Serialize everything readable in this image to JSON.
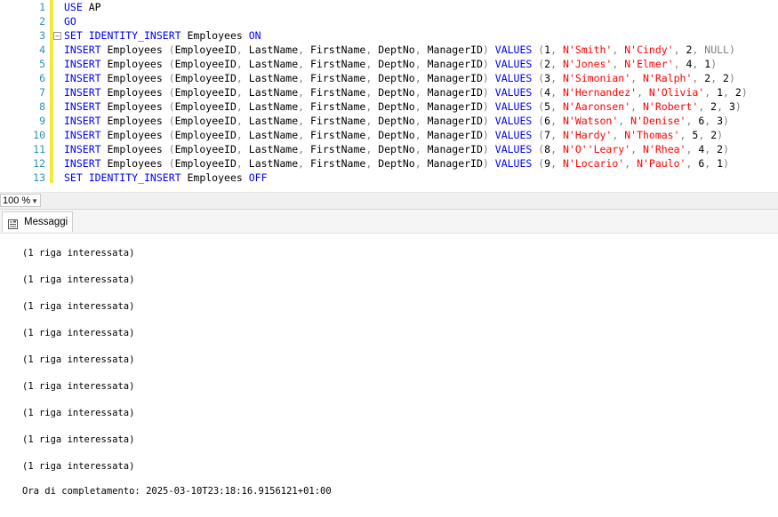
{
  "editor": {
    "lines": [
      {
        "n": "1",
        "tokens": [
          {
            "t": "USE",
            "c": "kw"
          },
          {
            "t": " AP",
            "c": "id"
          }
        ]
      },
      {
        "n": "2",
        "tokens": [
          {
            "t": "GO",
            "c": "kw"
          }
        ]
      },
      {
        "n": "3",
        "fold": true,
        "tokens": [
          {
            "t": "SET IDENTITY_INSERT",
            "c": "kw"
          },
          {
            "t": " Employees ",
            "c": "id"
          },
          {
            "t": "ON",
            "c": "kw"
          }
        ]
      },
      {
        "n": "4",
        "tokens": [
          {
            "t": "INSERT",
            "c": "kw"
          },
          {
            "t": " Employees ",
            "c": "id"
          },
          {
            "t": "(",
            "c": "gr"
          },
          {
            "t": "EmployeeID",
            "c": "id"
          },
          {
            "t": ", ",
            "c": "gr"
          },
          {
            "t": "LastName",
            "c": "id"
          },
          {
            "t": ", ",
            "c": "gr"
          },
          {
            "t": "FirstName",
            "c": "id"
          },
          {
            "t": ", ",
            "c": "gr"
          },
          {
            "t": "DeptNo",
            "c": "id"
          },
          {
            "t": ", ",
            "c": "gr"
          },
          {
            "t": "ManagerID",
            "c": "id"
          },
          {
            "t": ") ",
            "c": "gr"
          },
          {
            "t": "VALUES",
            "c": "kw"
          },
          {
            "t": " (",
            "c": "gr"
          },
          {
            "t": "1",
            "c": "num"
          },
          {
            "t": ", ",
            "c": "gr"
          },
          {
            "t": "N'Smith'",
            "c": "str"
          },
          {
            "t": ", ",
            "c": "gr"
          },
          {
            "t": "N'Cindy'",
            "c": "str"
          },
          {
            "t": ", ",
            "c": "gr"
          },
          {
            "t": "2",
            "c": "num"
          },
          {
            "t": ", ",
            "c": "gr"
          },
          {
            "t": "NULL",
            "c": "nul"
          },
          {
            "t": ")",
            "c": "gr"
          }
        ]
      },
      {
        "n": "5",
        "tokens": [
          {
            "t": "INSERT",
            "c": "kw"
          },
          {
            "t": " Employees ",
            "c": "id"
          },
          {
            "t": "(",
            "c": "gr"
          },
          {
            "t": "EmployeeID",
            "c": "id"
          },
          {
            "t": ", ",
            "c": "gr"
          },
          {
            "t": "LastName",
            "c": "id"
          },
          {
            "t": ", ",
            "c": "gr"
          },
          {
            "t": "FirstName",
            "c": "id"
          },
          {
            "t": ", ",
            "c": "gr"
          },
          {
            "t": "DeptNo",
            "c": "id"
          },
          {
            "t": ", ",
            "c": "gr"
          },
          {
            "t": "ManagerID",
            "c": "id"
          },
          {
            "t": ") ",
            "c": "gr"
          },
          {
            "t": "VALUES",
            "c": "kw"
          },
          {
            "t": " (",
            "c": "gr"
          },
          {
            "t": "2",
            "c": "num"
          },
          {
            "t": ", ",
            "c": "gr"
          },
          {
            "t": "N'Jones'",
            "c": "str"
          },
          {
            "t": ", ",
            "c": "gr"
          },
          {
            "t": "N'Elmer'",
            "c": "str"
          },
          {
            "t": ", ",
            "c": "gr"
          },
          {
            "t": "4",
            "c": "num"
          },
          {
            "t": ", ",
            "c": "gr"
          },
          {
            "t": "1",
            "c": "num"
          },
          {
            "t": ")",
            "c": "gr"
          }
        ]
      },
      {
        "n": "6",
        "tokens": [
          {
            "t": "INSERT",
            "c": "kw"
          },
          {
            "t": " Employees ",
            "c": "id"
          },
          {
            "t": "(",
            "c": "gr"
          },
          {
            "t": "EmployeeID",
            "c": "id"
          },
          {
            "t": ", ",
            "c": "gr"
          },
          {
            "t": "LastName",
            "c": "id"
          },
          {
            "t": ", ",
            "c": "gr"
          },
          {
            "t": "FirstName",
            "c": "id"
          },
          {
            "t": ", ",
            "c": "gr"
          },
          {
            "t": "DeptNo",
            "c": "id"
          },
          {
            "t": ", ",
            "c": "gr"
          },
          {
            "t": "ManagerID",
            "c": "id"
          },
          {
            "t": ") ",
            "c": "gr"
          },
          {
            "t": "VALUES",
            "c": "kw"
          },
          {
            "t": " (",
            "c": "gr"
          },
          {
            "t": "3",
            "c": "num"
          },
          {
            "t": ", ",
            "c": "gr"
          },
          {
            "t": "N'Simonian'",
            "c": "str"
          },
          {
            "t": ", ",
            "c": "gr"
          },
          {
            "t": "N'Ralph'",
            "c": "str"
          },
          {
            "t": ", ",
            "c": "gr"
          },
          {
            "t": "2",
            "c": "num"
          },
          {
            "t": ", ",
            "c": "gr"
          },
          {
            "t": "2",
            "c": "num"
          },
          {
            "t": ")",
            "c": "gr"
          }
        ]
      },
      {
        "n": "7",
        "tokens": [
          {
            "t": "INSERT",
            "c": "kw"
          },
          {
            "t": " Employees ",
            "c": "id"
          },
          {
            "t": "(",
            "c": "gr"
          },
          {
            "t": "EmployeeID",
            "c": "id"
          },
          {
            "t": ", ",
            "c": "gr"
          },
          {
            "t": "LastName",
            "c": "id"
          },
          {
            "t": ", ",
            "c": "gr"
          },
          {
            "t": "FirstName",
            "c": "id"
          },
          {
            "t": ", ",
            "c": "gr"
          },
          {
            "t": "DeptNo",
            "c": "id"
          },
          {
            "t": ", ",
            "c": "gr"
          },
          {
            "t": "ManagerID",
            "c": "id"
          },
          {
            "t": ") ",
            "c": "gr"
          },
          {
            "t": "VALUES",
            "c": "kw"
          },
          {
            "t": " (",
            "c": "gr"
          },
          {
            "t": "4",
            "c": "num"
          },
          {
            "t": ", ",
            "c": "gr"
          },
          {
            "t": "N'Hernandez'",
            "c": "str"
          },
          {
            "t": ", ",
            "c": "gr"
          },
          {
            "t": "N'Olivia'",
            "c": "str"
          },
          {
            "t": ", ",
            "c": "gr"
          },
          {
            "t": "1",
            "c": "num"
          },
          {
            "t": ", ",
            "c": "gr"
          },
          {
            "t": "2",
            "c": "num"
          },
          {
            "t": ")",
            "c": "gr"
          }
        ]
      },
      {
        "n": "8",
        "tokens": [
          {
            "t": "INSERT",
            "c": "kw"
          },
          {
            "t": " Employees ",
            "c": "id"
          },
          {
            "t": "(",
            "c": "gr"
          },
          {
            "t": "EmployeeID",
            "c": "id"
          },
          {
            "t": ", ",
            "c": "gr"
          },
          {
            "t": "LastName",
            "c": "id"
          },
          {
            "t": ", ",
            "c": "gr"
          },
          {
            "t": "FirstName",
            "c": "id"
          },
          {
            "t": ", ",
            "c": "gr"
          },
          {
            "t": "DeptNo",
            "c": "id"
          },
          {
            "t": ", ",
            "c": "gr"
          },
          {
            "t": "ManagerID",
            "c": "id"
          },
          {
            "t": ") ",
            "c": "gr"
          },
          {
            "t": "VALUES",
            "c": "kw"
          },
          {
            "t": " (",
            "c": "gr"
          },
          {
            "t": "5",
            "c": "num"
          },
          {
            "t": ", ",
            "c": "gr"
          },
          {
            "t": "N'Aaronsen'",
            "c": "str"
          },
          {
            "t": ", ",
            "c": "gr"
          },
          {
            "t": "N'Robert'",
            "c": "str"
          },
          {
            "t": ", ",
            "c": "gr"
          },
          {
            "t": "2",
            "c": "num"
          },
          {
            "t": ", ",
            "c": "gr"
          },
          {
            "t": "3",
            "c": "num"
          },
          {
            "t": ")",
            "c": "gr"
          }
        ]
      },
      {
        "n": "9",
        "tokens": [
          {
            "t": "INSERT",
            "c": "kw"
          },
          {
            "t": " Employees ",
            "c": "id"
          },
          {
            "t": "(",
            "c": "gr"
          },
          {
            "t": "EmployeeID",
            "c": "id"
          },
          {
            "t": ", ",
            "c": "gr"
          },
          {
            "t": "LastName",
            "c": "id"
          },
          {
            "t": ", ",
            "c": "gr"
          },
          {
            "t": "FirstName",
            "c": "id"
          },
          {
            "t": ", ",
            "c": "gr"
          },
          {
            "t": "DeptNo",
            "c": "id"
          },
          {
            "t": ", ",
            "c": "gr"
          },
          {
            "t": "ManagerID",
            "c": "id"
          },
          {
            "t": ") ",
            "c": "gr"
          },
          {
            "t": "VALUES",
            "c": "kw"
          },
          {
            "t": " (",
            "c": "gr"
          },
          {
            "t": "6",
            "c": "num"
          },
          {
            "t": ", ",
            "c": "gr"
          },
          {
            "t": "N'Watson'",
            "c": "str"
          },
          {
            "t": ", ",
            "c": "gr"
          },
          {
            "t": "N'Denise'",
            "c": "str"
          },
          {
            "t": ", ",
            "c": "gr"
          },
          {
            "t": "6",
            "c": "num"
          },
          {
            "t": ", ",
            "c": "gr"
          },
          {
            "t": "3",
            "c": "num"
          },
          {
            "t": ")",
            "c": "gr"
          }
        ]
      },
      {
        "n": "10",
        "tokens": [
          {
            "t": "INSERT",
            "c": "kw"
          },
          {
            "t": " Employees ",
            "c": "id"
          },
          {
            "t": "(",
            "c": "gr"
          },
          {
            "t": "EmployeeID",
            "c": "id"
          },
          {
            "t": ", ",
            "c": "gr"
          },
          {
            "t": "LastName",
            "c": "id"
          },
          {
            "t": ", ",
            "c": "gr"
          },
          {
            "t": "FirstName",
            "c": "id"
          },
          {
            "t": ", ",
            "c": "gr"
          },
          {
            "t": "DeptNo",
            "c": "id"
          },
          {
            "t": ", ",
            "c": "gr"
          },
          {
            "t": "ManagerID",
            "c": "id"
          },
          {
            "t": ") ",
            "c": "gr"
          },
          {
            "t": "VALUES",
            "c": "kw"
          },
          {
            "t": " (",
            "c": "gr"
          },
          {
            "t": "7",
            "c": "num"
          },
          {
            "t": ", ",
            "c": "gr"
          },
          {
            "t": "N'Hardy'",
            "c": "str"
          },
          {
            "t": ", ",
            "c": "gr"
          },
          {
            "t": "N'Thomas'",
            "c": "str"
          },
          {
            "t": ", ",
            "c": "gr"
          },
          {
            "t": "5",
            "c": "num"
          },
          {
            "t": ", ",
            "c": "gr"
          },
          {
            "t": "2",
            "c": "num"
          },
          {
            "t": ")",
            "c": "gr"
          }
        ]
      },
      {
        "n": "11",
        "tokens": [
          {
            "t": "INSERT",
            "c": "kw"
          },
          {
            "t": " Employees ",
            "c": "id"
          },
          {
            "t": "(",
            "c": "gr"
          },
          {
            "t": "EmployeeID",
            "c": "id"
          },
          {
            "t": ", ",
            "c": "gr"
          },
          {
            "t": "LastName",
            "c": "id"
          },
          {
            "t": ", ",
            "c": "gr"
          },
          {
            "t": "FirstName",
            "c": "id"
          },
          {
            "t": ", ",
            "c": "gr"
          },
          {
            "t": "DeptNo",
            "c": "id"
          },
          {
            "t": ", ",
            "c": "gr"
          },
          {
            "t": "ManagerID",
            "c": "id"
          },
          {
            "t": ") ",
            "c": "gr"
          },
          {
            "t": "VALUES",
            "c": "kw"
          },
          {
            "t": " (",
            "c": "gr"
          },
          {
            "t": "8",
            "c": "num"
          },
          {
            "t": ", ",
            "c": "gr"
          },
          {
            "t": "N'O''Leary'",
            "c": "str"
          },
          {
            "t": ", ",
            "c": "gr"
          },
          {
            "t": "N'Rhea'",
            "c": "str"
          },
          {
            "t": ", ",
            "c": "gr"
          },
          {
            "t": "4",
            "c": "num"
          },
          {
            "t": ", ",
            "c": "gr"
          },
          {
            "t": "2",
            "c": "num"
          },
          {
            "t": ")",
            "c": "gr"
          }
        ]
      },
      {
        "n": "12",
        "tokens": [
          {
            "t": "INSERT",
            "c": "kw"
          },
          {
            "t": " Employees ",
            "c": "id"
          },
          {
            "t": "(",
            "c": "gr"
          },
          {
            "t": "EmployeeID",
            "c": "id"
          },
          {
            "t": ", ",
            "c": "gr"
          },
          {
            "t": "LastName",
            "c": "id"
          },
          {
            "t": ", ",
            "c": "gr"
          },
          {
            "t": "FirstName",
            "c": "id"
          },
          {
            "t": ", ",
            "c": "gr"
          },
          {
            "t": "DeptNo",
            "c": "id"
          },
          {
            "t": ", ",
            "c": "gr"
          },
          {
            "t": "ManagerID",
            "c": "id"
          },
          {
            "t": ") ",
            "c": "gr"
          },
          {
            "t": "VALUES",
            "c": "kw"
          },
          {
            "t": " (",
            "c": "gr"
          },
          {
            "t": "9",
            "c": "num"
          },
          {
            "t": ", ",
            "c": "gr"
          },
          {
            "t": "N'Locario'",
            "c": "str"
          },
          {
            "t": ", ",
            "c": "gr"
          },
          {
            "t": "N'Paulo'",
            "c": "str"
          },
          {
            "t": ", ",
            "c": "gr"
          },
          {
            "t": "6",
            "c": "num"
          },
          {
            "t": ", ",
            "c": "gr"
          },
          {
            "t": "1",
            "c": "num"
          },
          {
            "t": ")",
            "c": "gr"
          }
        ]
      },
      {
        "n": "13",
        "tokens": [
          {
            "t": "SET IDENTITY_INSERT",
            "c": "kw"
          },
          {
            "t": " Employees ",
            "c": "id"
          },
          {
            "t": "OFF",
            "c": "kw"
          }
        ]
      }
    ]
  },
  "zoom": {
    "value": "100 %"
  },
  "results_tab": {
    "label": "Messaggi",
    "icon": "messages-icon"
  },
  "messages": [
    "(1 riga interessata)",
    "(1 riga interessata)",
    "(1 riga interessata)",
    "(1 riga interessata)",
    "(1 riga interessata)",
    "(1 riga interessata)",
    "(1 riga interessata)",
    "(1 riga interessata)",
    "(1 riga interessata)",
    "Ora di completamento: 2025-03-10T23:18:16.9156121+01:00"
  ],
  "colors": {
    "keyword": "#0000ff",
    "string": "#ff0000",
    "gray": "#808080",
    "line_number": "#2b91af",
    "change_bar": "#f3ea3c"
  }
}
